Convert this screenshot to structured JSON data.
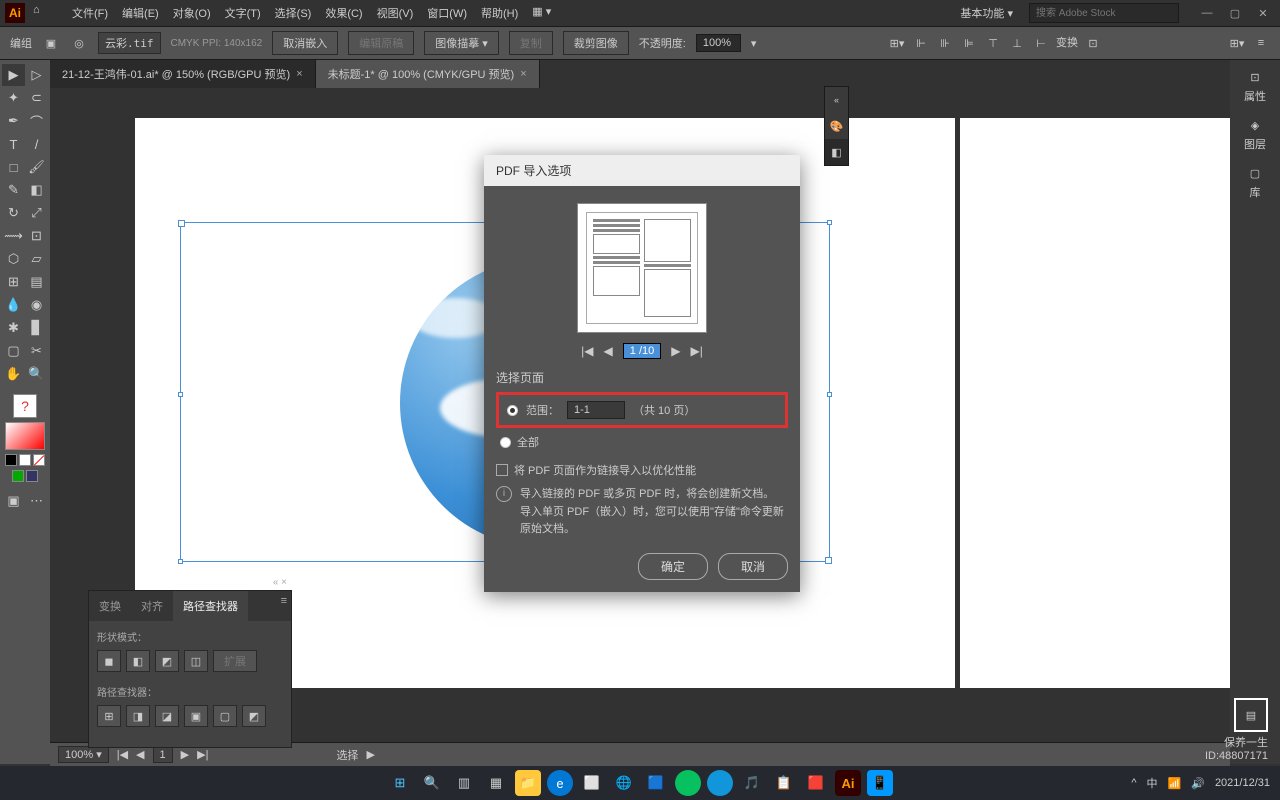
{
  "titlebar": {
    "menus": [
      "文件(F)",
      "编辑(E)",
      "对象(O)",
      "文字(T)",
      "选择(S)",
      "效果(C)",
      "视图(V)",
      "窗口(W)",
      "帮助(H)"
    ],
    "workspace": "基本功能",
    "search_placeholder": "搜索 Adobe Stock"
  },
  "controlbar": {
    "label": "编组",
    "filename": "云彩.tif",
    "colorinfo": "CMYK PPI: 140x162",
    "cancel_embed": "取消嵌入",
    "edit_orig": "编辑原稿",
    "image_desc": "图像描摹",
    "recolor": "复制",
    "crop": "裁剪图像",
    "opacity_label": "不透明度:",
    "opacity_val": "100%",
    "transform": "变换"
  },
  "tabs": [
    {
      "name": "21-12-王鸿伟-01.ai* @ 150% (RGB/GPU 预览)"
    },
    {
      "name": "未标题-1* @ 100% (CMYK/GPU 预览)"
    }
  ],
  "dialog": {
    "title": "PDF 导入选项",
    "page_indicator": "1 /10",
    "section": "选择页面",
    "range_label": "范围：",
    "range_val": "1-1",
    "total": "（共 10 页）",
    "all": "全部",
    "link_chk": "将 PDF 页面作为链接导入以优化性能",
    "info": "导入链接的 PDF 或多页 PDF 时，将会创建新文档。\n导入单页 PDF（嵌入）时，您可以使用\"存储\"命令更新原始文档。",
    "ok": "确定",
    "cancel": "取消"
  },
  "pathfinder": {
    "tab1": "变换",
    "tab2": "对齐",
    "tab3": "路径查找器",
    "shape_mode": "形状模式：",
    "expand": "扩展",
    "pathfinders": "路径查找器："
  },
  "right_panel": {
    "props": "属性",
    "layers": "图层",
    "libs": "库"
  },
  "statusbar": {
    "zoom": "100%",
    "page": "1",
    "mode": "选择"
  },
  "watermark": {
    "brand": "保养一生",
    "id": "ID:48807171"
  },
  "taskbar": {
    "time": "2021/12/31"
  }
}
